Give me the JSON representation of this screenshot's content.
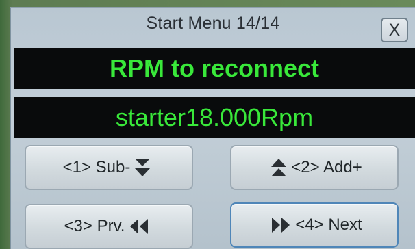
{
  "window": {
    "title": "Start Menu 14/14",
    "close_label": "X"
  },
  "display": {
    "heading": "RPM to reconnect",
    "value": "starter18.000Rpm"
  },
  "buttons": {
    "sub": {
      "label": "<1> Sub-",
      "icon": "double-chevron-down-icon"
    },
    "add": {
      "label": "<2> Add+",
      "icon": "double-chevron-up-icon"
    },
    "prev": {
      "label": "<3> Prv.",
      "icon": "double-arrow-left-icon"
    },
    "next": {
      "label": "<4> Next",
      "icon": "double-arrow-right-icon"
    }
  },
  "colors": {
    "display_text": "#39e83a",
    "display_bg": "#090b0c",
    "screen_bg": "#c3cfd8"
  }
}
